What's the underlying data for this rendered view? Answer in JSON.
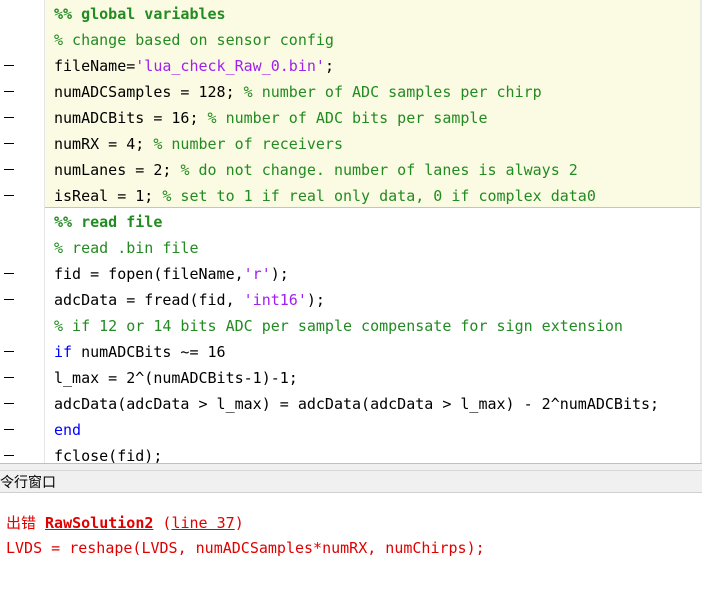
{
  "editor": {
    "lines": [
      {
        "has_marker": false,
        "segments": [
          {
            "t": "sec",
            "s": "%% global variables"
          }
        ]
      },
      {
        "has_marker": false,
        "segments": [
          {
            "t": "cm",
            "s": "% change based on sensor config"
          }
        ]
      },
      {
        "has_marker": true,
        "segments": [
          {
            "t": "",
            "s": "fileName="
          },
          {
            "t": "str",
            "s": "'lua_check_Raw_0.bin'"
          },
          {
            "t": "",
            "s": ";"
          }
        ]
      },
      {
        "has_marker": true,
        "segments": [
          {
            "t": "",
            "s": "numADCSamples = 128; "
          },
          {
            "t": "cm",
            "s": "% number of ADC samples per chirp"
          }
        ]
      },
      {
        "has_marker": true,
        "segments": [
          {
            "t": "",
            "s": "numADCBits = 16; "
          },
          {
            "t": "cm",
            "s": "% number of ADC bits per sample"
          }
        ]
      },
      {
        "has_marker": true,
        "segments": [
          {
            "t": "",
            "s": "numRX = 4; "
          },
          {
            "t": "cm",
            "s": "% number of receivers"
          }
        ]
      },
      {
        "has_marker": true,
        "segments": [
          {
            "t": "",
            "s": "numLanes = 2; "
          },
          {
            "t": "cm",
            "s": "% do not change. number of lanes is always 2"
          }
        ]
      },
      {
        "has_marker": true,
        "segments": [
          {
            "t": "",
            "s": "isReal = 1; "
          },
          {
            "t": "cm",
            "s": "% set to 1 if real only data, 0 if complex data0"
          }
        ]
      },
      {
        "has_marker": false,
        "segments": [
          {
            "t": "sec",
            "s": "%% read file"
          }
        ]
      },
      {
        "has_marker": false,
        "segments": [
          {
            "t": "cm",
            "s": "% read .bin file"
          }
        ]
      },
      {
        "has_marker": true,
        "segments": [
          {
            "t": "",
            "s": "fid = fopen(fileName,"
          },
          {
            "t": "str",
            "s": "'r'"
          },
          {
            "t": "",
            "s": ");"
          }
        ]
      },
      {
        "has_marker": true,
        "segments": [
          {
            "t": "",
            "s": "adcData = fread(fid, "
          },
          {
            "t": "str",
            "s": "'int16'"
          },
          {
            "t": "",
            "s": ");"
          }
        ]
      },
      {
        "has_marker": false,
        "segments": [
          {
            "t": "cm",
            "s": "% if 12 or 14 bits ADC per sample compensate for sign extension"
          }
        ]
      },
      {
        "has_marker": true,
        "segments": [
          {
            "t": "kw",
            "s": "if"
          },
          {
            "t": "",
            "s": " numADCBits ~= 16"
          }
        ]
      },
      {
        "has_marker": true,
        "segments": [
          {
            "t": "",
            "s": "l_max = 2^(numADCBits-1)-1;"
          }
        ]
      },
      {
        "has_marker": true,
        "segments": [
          {
            "t": "",
            "s": "adcData(adcData > l_max) = adcData(adcData > l_max) - 2^numADCBits;"
          }
        ]
      },
      {
        "has_marker": true,
        "segments": [
          {
            "t": "kw",
            "s": "end"
          }
        ]
      },
      {
        "has_marker": true,
        "segments": [
          {
            "t": "",
            "s": "fclose(fid);"
          }
        ]
      }
    ]
  },
  "command_window": {
    "title": "令行窗口",
    "error_prefix": "出错 ",
    "error_function": "RawSolution2",
    "error_open_paren": " (",
    "error_line_link": "line 37",
    "error_close_paren": ")",
    "error_code": "LVDS = reshape(LVDS, numADCSamples*numRX, numChirps);"
  }
}
